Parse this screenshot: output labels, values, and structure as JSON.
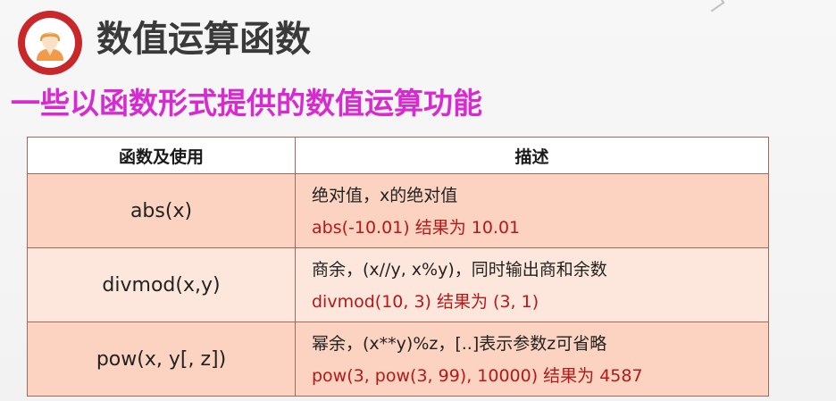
{
  "slide": {
    "title": "数值运算函数",
    "subtitle": "一些以函数形式提供的数值运算功能"
  },
  "table": {
    "headers": [
      "函数及使用",
      "描述"
    ],
    "rows": [
      {
        "function": "abs(x)",
        "description": "绝对值，x的绝对值",
        "example": "abs(-10.01) 结果为 10.01"
      },
      {
        "function": "divmod(x,y)",
        "description": "商余，(x//y, x%y)，同时输出商和余数",
        "example": "divmod(10, 3) 结果为 (3, 1)"
      },
      {
        "function": "pow(x, y[, z])",
        "description": "幂余，(x**y)%z，[..]表示参数z可省略",
        "example": "pow(3, pow(3, 99), 10000) 结果为 4587"
      }
    ]
  },
  "colors": {
    "title_icon": "#c8282a",
    "subtitle": "#d72ad1",
    "example_text": "#b31919",
    "row_fill_dark": "#fbd3c0",
    "row_fill_light": "#fde7dc",
    "border": "#9e6b5a"
  },
  "icons": {
    "title_icon": "person-avatar-icon"
  }
}
